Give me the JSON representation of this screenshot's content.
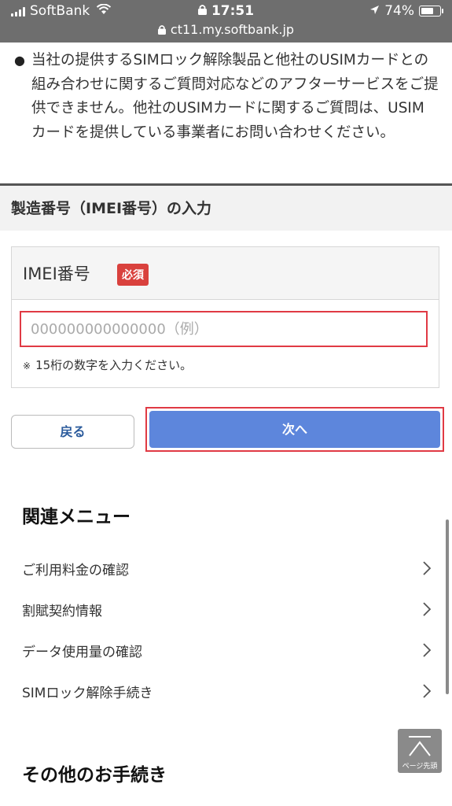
{
  "status_bar": {
    "carrier": "SoftBank",
    "time": "17:51",
    "battery": "74%",
    "battery_level": 0.74,
    "url": "ct11.my.softbank.jp"
  },
  "notice": {
    "text": "当社の提供するSIMロック解除製品と他社のUSIMカードとの組み合わせに関するご質問対応などのアフターサービスをご提供できません。他社のUSIMカードに関するご質問は、USIMカードを提供している事業者にお問い合わせください。"
  },
  "section": {
    "title": "製造番号（IMEI番号）の入力"
  },
  "form": {
    "imei_label": "IMEI番号",
    "required_badge": "必須",
    "imei_value": "",
    "imei_placeholder": "000000000000000（例）",
    "hint": "15桁の数字を入力ください。"
  },
  "buttons": {
    "back": "戻る",
    "next": "次へ"
  },
  "related_menu": {
    "title": "関連メニュー",
    "items": [
      {
        "label": "ご利用料金の確認"
      },
      {
        "label": "割賦契約情報"
      },
      {
        "label": "データ使用量の確認"
      },
      {
        "label": "SIMロック解除手続き"
      }
    ]
  },
  "other": {
    "title": "その他のお手続き"
  },
  "page_top": {
    "label": "ページ先頭"
  },
  "colors": {
    "required_badge": "#d9413d",
    "next_button": "#5d86dc",
    "highlight": "#e03a44",
    "back_text": "#2b5b9c"
  }
}
